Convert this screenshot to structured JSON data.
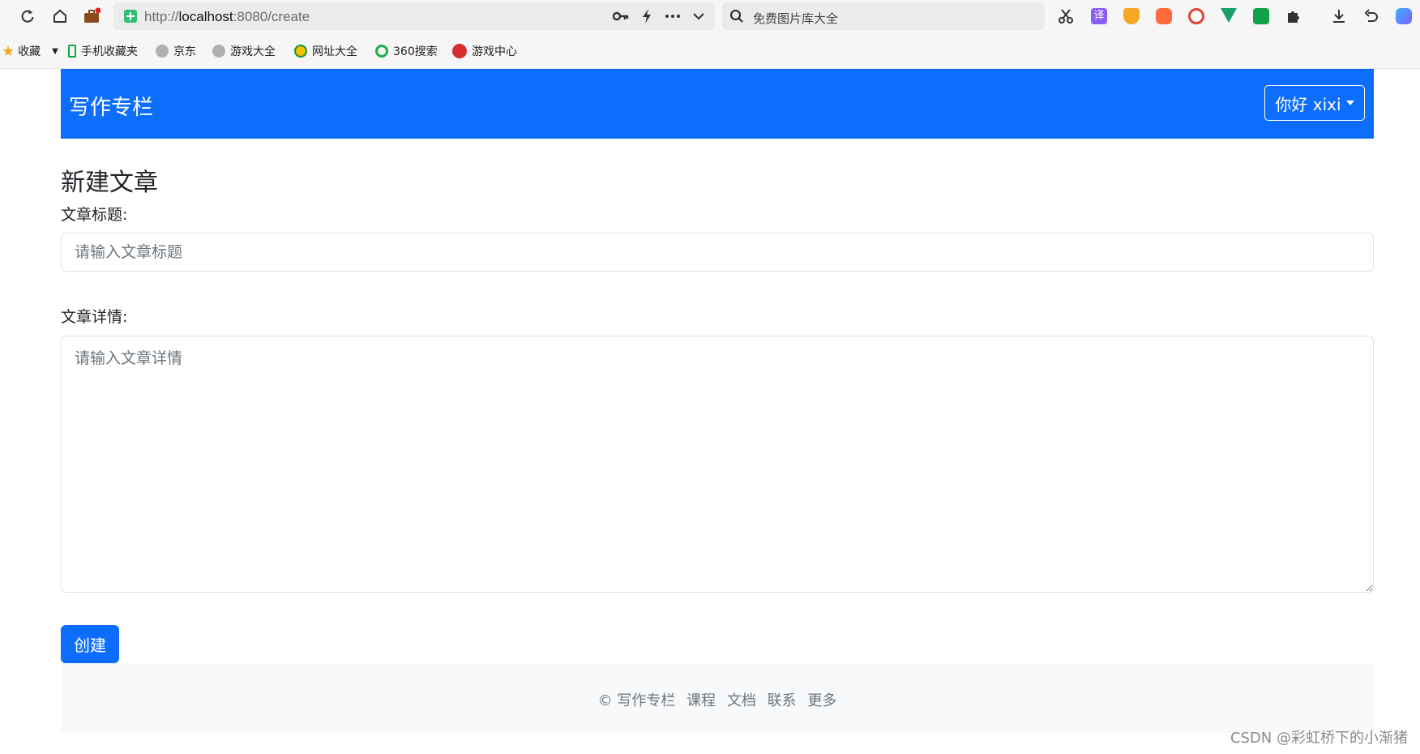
{
  "browser": {
    "url_prefix": "http://",
    "url_host": "localhost",
    "url_rest": ":8080/create",
    "search_placeholder": "免费图片库大全",
    "ext_translate_label": "译",
    "bookmarks": [
      {
        "label": "收藏",
        "icon": "star-icon"
      },
      {
        "label": "手机收藏夹",
        "icon": "phone-icon"
      },
      {
        "label": "京东",
        "icon": "globe-icon"
      },
      {
        "label": "游戏大全",
        "icon": "globe-icon"
      },
      {
        "label": "网址大全",
        "icon": "nav-icon"
      },
      {
        "label": "360搜索",
        "icon": "search360-icon"
      },
      {
        "label": "游戏中心",
        "icon": "game-icon"
      }
    ]
  },
  "navbar": {
    "brand": "写作专栏",
    "user_greeting": "你好 xixi"
  },
  "form": {
    "page_title": "新建文章",
    "title_label": "文章标题:",
    "title_placeholder": "请输入文章标题",
    "content_label": "文章详情:",
    "content_placeholder": "请输入文章详情",
    "submit_label": "创建"
  },
  "footer": {
    "copyright": "© 写作专栏",
    "links": [
      "课程",
      "文档",
      "联系",
      "更多"
    ]
  },
  "watermark": "CSDN @彩虹桥下的小渐猪",
  "colors": {
    "primary": "#0d6efd",
    "footer_bg": "#f8f9fa",
    "muted_text": "#6c757d"
  }
}
